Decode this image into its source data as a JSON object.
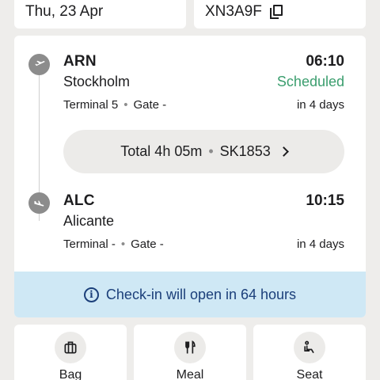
{
  "header": {
    "date": "Thu, 23 Apr",
    "booking_ref": "XN3A9F",
    "copy_icon": "copy-icon"
  },
  "flight": {
    "departure": {
      "code": "ARN",
      "city": "Stockholm",
      "time": "06:10",
      "status": "Scheduled",
      "terminal": "Terminal 5",
      "gate": "Gate -",
      "relative": "in 4 days"
    },
    "summary": {
      "duration": "Total 4h 05m",
      "flight_number": "SK1853"
    },
    "arrival": {
      "code": "ALC",
      "city": "Alicante",
      "time": "10:15",
      "terminal": "Terminal -",
      "gate": "Gate -",
      "relative": "in 4 days"
    }
  },
  "checkin": {
    "message": "Check-in will open in 64 hours"
  },
  "services": [
    {
      "label": "Bag",
      "icon": "bag-icon"
    },
    {
      "label": "Meal",
      "icon": "meal-icon"
    },
    {
      "label": "Seat",
      "icon": "seat-icon"
    }
  ],
  "colors": {
    "background": "#eeedeb",
    "status_scheduled": "#3b9e6e",
    "checkin_banner": "#cfe8f5",
    "checkin_text": "#1b3f7a"
  }
}
